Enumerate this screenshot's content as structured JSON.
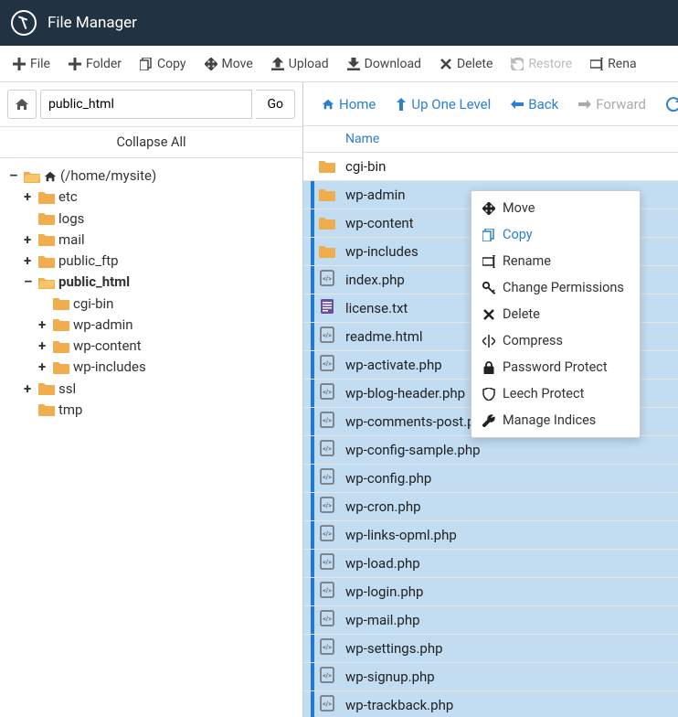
{
  "title": "File Manager",
  "toolbar": [
    {
      "id": "file",
      "label": "File",
      "icon": "plus"
    },
    {
      "id": "folder",
      "label": "Folder",
      "icon": "plus"
    },
    {
      "id": "copy",
      "label": "Copy",
      "icon": "copy"
    },
    {
      "id": "move",
      "label": "Move",
      "icon": "move"
    },
    {
      "id": "upload",
      "label": "Upload",
      "icon": "upload"
    },
    {
      "id": "download",
      "label": "Download",
      "icon": "download"
    },
    {
      "id": "delete",
      "label": "Delete",
      "icon": "delete"
    },
    {
      "id": "restore",
      "label": "Restore",
      "icon": "restore",
      "disabled": true
    },
    {
      "id": "rename",
      "label": "Rena",
      "icon": "rename"
    }
  ],
  "path_input": "public_html",
  "go_label": "Go",
  "collapse_label": "Collapse All",
  "tree": {
    "root_label": "(/home/mysite)",
    "items": [
      {
        "depth": 1,
        "toggle": "+",
        "label": "etc",
        "icon": "folder"
      },
      {
        "depth": 1,
        "toggle": "",
        "label": "logs",
        "icon": "folder"
      },
      {
        "depth": 1,
        "toggle": "+",
        "label": "mail",
        "icon": "folder"
      },
      {
        "depth": 1,
        "toggle": "+",
        "label": "public_ftp",
        "icon": "folder"
      },
      {
        "depth": 1,
        "toggle": "–",
        "label": "public_html",
        "icon": "folder-open",
        "bold": true
      },
      {
        "depth": 2,
        "toggle": "",
        "label": "cgi-bin",
        "icon": "folder"
      },
      {
        "depth": 2,
        "toggle": "+",
        "label": "wp-admin",
        "icon": "folder"
      },
      {
        "depth": 2,
        "toggle": "+",
        "label": "wp-content",
        "icon": "folder"
      },
      {
        "depth": 2,
        "toggle": "+",
        "label": "wp-includes",
        "icon": "folder"
      },
      {
        "depth": 1,
        "toggle": "+",
        "label": "ssl",
        "icon": "folder"
      },
      {
        "depth": 1,
        "toggle": "",
        "label": "tmp",
        "icon": "folder"
      }
    ]
  },
  "nav": {
    "home": "Home",
    "up": "Up One Level",
    "back": "Back",
    "forward": "Forward"
  },
  "column_name": "Name",
  "files": [
    {
      "name": "cgi-bin",
      "type": "folder",
      "selected": false
    },
    {
      "name": "wp-admin",
      "type": "folder",
      "selected": true
    },
    {
      "name": "wp-content",
      "type": "folder",
      "selected": true
    },
    {
      "name": "wp-includes",
      "type": "folder",
      "selected": true
    },
    {
      "name": "index.php",
      "type": "php",
      "selected": true
    },
    {
      "name": "license.txt",
      "type": "txt",
      "selected": true
    },
    {
      "name": "readme.html",
      "type": "php",
      "selected": true
    },
    {
      "name": "wp-activate.php",
      "type": "php",
      "selected": true
    },
    {
      "name": "wp-blog-header.php",
      "type": "php",
      "selected": true
    },
    {
      "name": "wp-comments-post.php",
      "type": "php",
      "selected": true
    },
    {
      "name": "wp-config-sample.php",
      "type": "php",
      "selected": true
    },
    {
      "name": "wp-config.php",
      "type": "php",
      "selected": true
    },
    {
      "name": "wp-cron.php",
      "type": "php",
      "selected": true
    },
    {
      "name": "wp-links-opml.php",
      "type": "php",
      "selected": true
    },
    {
      "name": "wp-load.php",
      "type": "php",
      "selected": true
    },
    {
      "name": "wp-login.php",
      "type": "php",
      "selected": true
    },
    {
      "name": "wp-mail.php",
      "type": "php",
      "selected": true
    },
    {
      "name": "wp-settings.php",
      "type": "php",
      "selected": true
    },
    {
      "name": "wp-signup.php",
      "type": "php",
      "selected": true
    },
    {
      "name": "wp-trackback.php",
      "type": "php",
      "selected": true
    }
  ],
  "context_menu": [
    {
      "id": "move",
      "label": "Move",
      "icon": "move"
    },
    {
      "id": "copy",
      "label": "Copy",
      "icon": "copy",
      "blue": true
    },
    {
      "id": "rename",
      "label": "Rename",
      "icon": "rename"
    },
    {
      "id": "perms",
      "label": "Change Permissions",
      "icon": "key"
    },
    {
      "id": "delete",
      "label": "Delete",
      "icon": "delete"
    },
    {
      "id": "compress",
      "label": "Compress",
      "icon": "compress"
    },
    {
      "id": "pwprotect",
      "label": "Password Protect",
      "icon": "lock"
    },
    {
      "id": "leech",
      "label": "Leech Protect",
      "icon": "shield"
    },
    {
      "id": "indices",
      "label": "Manage Indices",
      "icon": "wrench"
    }
  ]
}
